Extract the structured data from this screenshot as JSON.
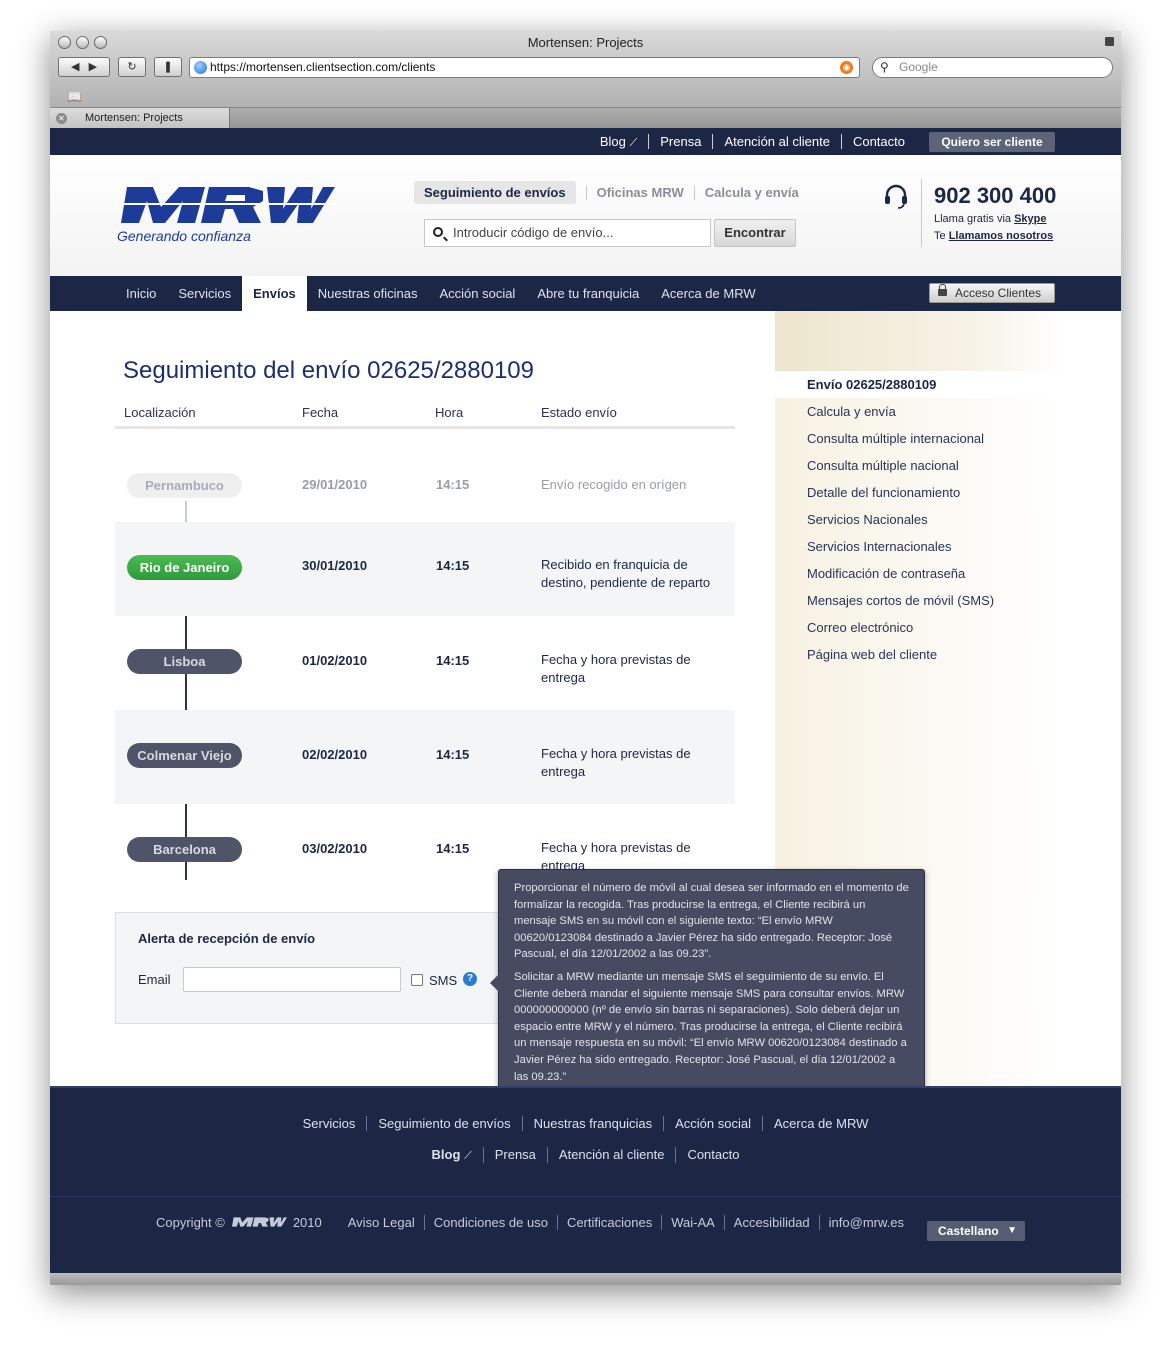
{
  "browser": {
    "window_title": "Mortensen: Projects",
    "url": "https://mortensen.clientsection.com/clients",
    "search_placeholder": "Google",
    "tab_title": "Mortensen: Projects"
  },
  "topbar": {
    "links": [
      "Blog",
      "Prensa",
      "Atención al cliente",
      "Contacto"
    ],
    "cta": "Quiero ser cliente"
  },
  "header": {
    "logo_text": "MRW",
    "slogan": "Generando confianza",
    "nav": [
      "Seguimiento de envíos",
      "Oficinas MRW",
      "Calcula y envía"
    ],
    "search_placeholder": "Introducir código de envío...",
    "search_button": "Encontrar",
    "phone": "902 300 400",
    "phone_line1_prefix": "Llama gratis via ",
    "phone_line1_link": "Skype",
    "phone_line2_prefix": "Te ",
    "phone_line2_link": "Llamamos nosotros"
  },
  "mainnav": {
    "items": [
      "Inicio",
      "Servicios",
      "Envíos",
      "Nuestras oficinas",
      "Acción social",
      "Abre tu franquicia",
      "Acerca de MRW"
    ],
    "active": "Envíos",
    "access_button": "Acceso Clientes"
  },
  "tracking": {
    "title": "Seguimiento del envío 02625/2880109",
    "columns": [
      "Localización",
      "Fecha",
      "Hora",
      "Estado envío"
    ],
    "rows": [
      {
        "location": "Pernambuco",
        "date": "29/01/2010",
        "time": "14:15",
        "status": "Envío recogido en orígen",
        "state": "done"
      },
      {
        "location": "Rio de Janeiro",
        "date": "30/01/2010",
        "time": "14:15",
        "status": "Recibido en franquicia de destino, pendiente de reparto",
        "state": "current"
      },
      {
        "location": "Lisboa",
        "date": "01/02/2010",
        "time": "14:15",
        "status": "Fecha y hora previstas de entrega",
        "state": "planned"
      },
      {
        "location": "Colmenar Viejo",
        "date": "02/02/2010",
        "time": "14:15",
        "status": "Fecha y hora previstas de entrega",
        "state": "planned"
      },
      {
        "location": "Barcelona",
        "date": "03/02/2010",
        "time": "14:15",
        "status": "Fecha y hora previstas de entrega",
        "state": "planned"
      }
    ]
  },
  "alert": {
    "title": "Alerta de recepción de envío",
    "email_label": "Email",
    "sms_label": "SMS",
    "help": "?"
  },
  "tooltip": {
    "p1": "Proporcionar el número de móvil al cual desea ser informado en el momento de formalizar la recogida. Tras producirse la entrega, el Cliente recibirá un mensaje SMS  en su móvil con el siguiente texto: “El envío MRW 00620/0123084 destinado a Javier Pérez ha sido entregado. Receptor: José Pascual, el día 12/01/2002 a las 09.23”.",
    "p2": "Solicitar a MRW mediante un mensaje SMS el seguimiento de su envío. El Cliente deberá mandar el siguiente mensaje SMS para consultar envíos. MRW 000000000000 (nº de envío sin barras ni separaciones). Solo deberá dejar un espacio entre MRW y el número. Tras producirse la entrega, el Cliente recibirá un mensaje respuesta en su móvil: “El envío MRW 00620/0123084 destinado a Javier Pérez ha sido entregado. Receptor: José Pascual, el día 12/01/2002 a las 09.23.”"
  },
  "sidebar": {
    "active": "Envío 02625/2880109",
    "items": [
      "Calcula y envía",
      "Consulta múltiple internacional",
      "Consulta múltiple nacional",
      "Detalle del funcionamiento",
      "Servicios Nacionales",
      "Servicios Internacionales",
      "Modificación de contraseña",
      "Mensajes cortos de móvil (SMS)",
      "Correo electrónico",
      "Página web del cliente"
    ]
  },
  "footer": {
    "row1": [
      "Servicios",
      "Seguimiento de envíos",
      "Nuestras franquicias",
      "Acción social",
      "Acerca de MRW"
    ],
    "row2": [
      "Blog",
      "Prensa",
      "Atención al cliente",
      "Contacto"
    ],
    "copyright": "Copyright ©",
    "year": "2010",
    "legal": [
      "Aviso Legal",
      "Condiciones de uso",
      "Certificaciones",
      "Wai-AA",
      "Accesibilidad",
      "info@mrw.es"
    ],
    "language": "Castellano"
  },
  "colors": {
    "navy": "#1c2746",
    "brand_blue": "#1d3c9a",
    "current_green": "#3aa845",
    "planned_pill": "#505468",
    "done_pill": "#efefef",
    "sidebar_beige": "#f3eedd"
  }
}
